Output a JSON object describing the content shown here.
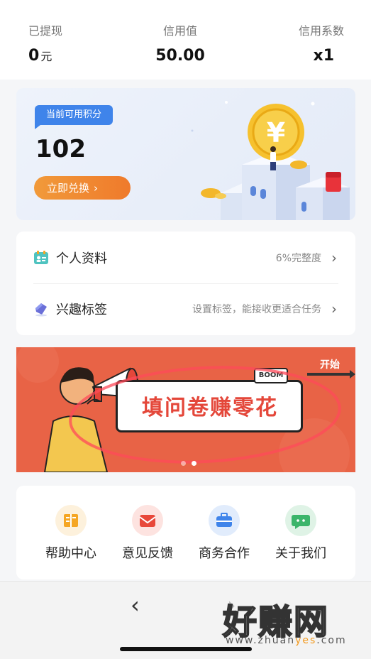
{
  "stats": {
    "withdrawn": {
      "label": "已提现",
      "value": "0",
      "unit": "元"
    },
    "credit": {
      "label": "信用值",
      "value": "50.00"
    },
    "coefficient": {
      "label": "信用系数",
      "value": "x1"
    }
  },
  "points": {
    "tag": "当前可用积分",
    "value": "102",
    "redeem_label": "立即兑换",
    "redeem_arrow": "›"
  },
  "profile": {
    "items": [
      {
        "title": "个人资料",
        "hint": "6%完整度",
        "icon": "id-card-icon"
      },
      {
        "title": "兴趣标签",
        "hint": "设置标签，能接收更适合任务",
        "icon": "tag-icon"
      }
    ],
    "chevron": "›"
  },
  "banner": {
    "title": "填问卷赚零花",
    "start": "开始",
    "badge": "BOOM",
    "page_count": 2,
    "active_page": 2
  },
  "services": {
    "items": [
      {
        "label": "帮助中心",
        "icon": "book-icon",
        "color": "#f5a623"
      },
      {
        "label": "意见反馈",
        "icon": "mail-icon",
        "color": "#e8483a"
      },
      {
        "label": "商务合作",
        "icon": "briefcase-icon",
        "color": "#3f84ea"
      },
      {
        "label": "关于我们",
        "icon": "chat-icon",
        "color": "#3bb56a"
      }
    ]
  },
  "nav": {
    "back": "‹",
    "forward": "›"
  },
  "watermark": {
    "title": "好赚网",
    "url_prefix": "www.zhuan",
    "url_highlight": "yes",
    "url_suffix": ".com"
  },
  "colors": {
    "accent_blue": "#3f84ea",
    "accent_orange": "#ef7a2b",
    "banner_red": "#e86346"
  }
}
